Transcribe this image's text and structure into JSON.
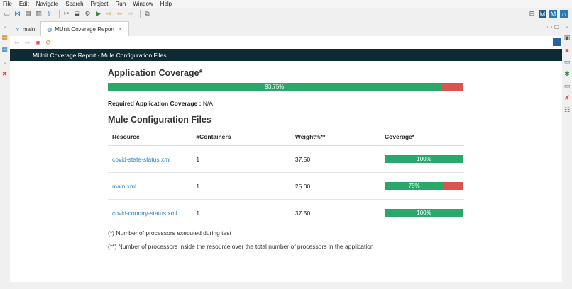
{
  "menu": [
    "File",
    "Edit",
    "Navigate",
    "Search",
    "Project",
    "Run",
    "Window",
    "Help"
  ],
  "tabs": [
    {
      "label": "main",
      "active": false
    },
    {
      "label": "MUnit Coverage Report",
      "active": true
    }
  ],
  "header": {
    "title": "MUnit Coverage Report - Mule Configuration Files"
  },
  "app_coverage": {
    "title": "Application Coverage*",
    "percent_label": "93.75%",
    "percent": 93.75,
    "required_label": "Required Application Coverage :",
    "required_value": "N/A"
  },
  "files": {
    "title": "Mule Configuration Files",
    "columns": [
      "Resource",
      "#Containers",
      "Weight%**",
      "Coverage*"
    ],
    "rows": [
      {
        "resource": "covid-state-status.xml",
        "containers": "1",
        "weight": "37.50",
        "coverage_label": "100%",
        "coverage": 100
      },
      {
        "resource": "main.xml",
        "containers": "1",
        "weight": "25.00",
        "coverage_label": "75%",
        "coverage": 75
      },
      {
        "resource": "covid-country-status.xml",
        "containers": "1",
        "weight": "37.50",
        "coverage_label": "100%",
        "coverage": 100
      }
    ]
  },
  "notes": [
    "(*) Number of processors executed during test",
    "(**) Number of processors inside the resource over the total number of processors in the application"
  ],
  "colors": {
    "covered": "#2aa86c",
    "uncovered": "#d9534f",
    "header_bg": "#0f2a32",
    "link": "#2a86c9"
  }
}
